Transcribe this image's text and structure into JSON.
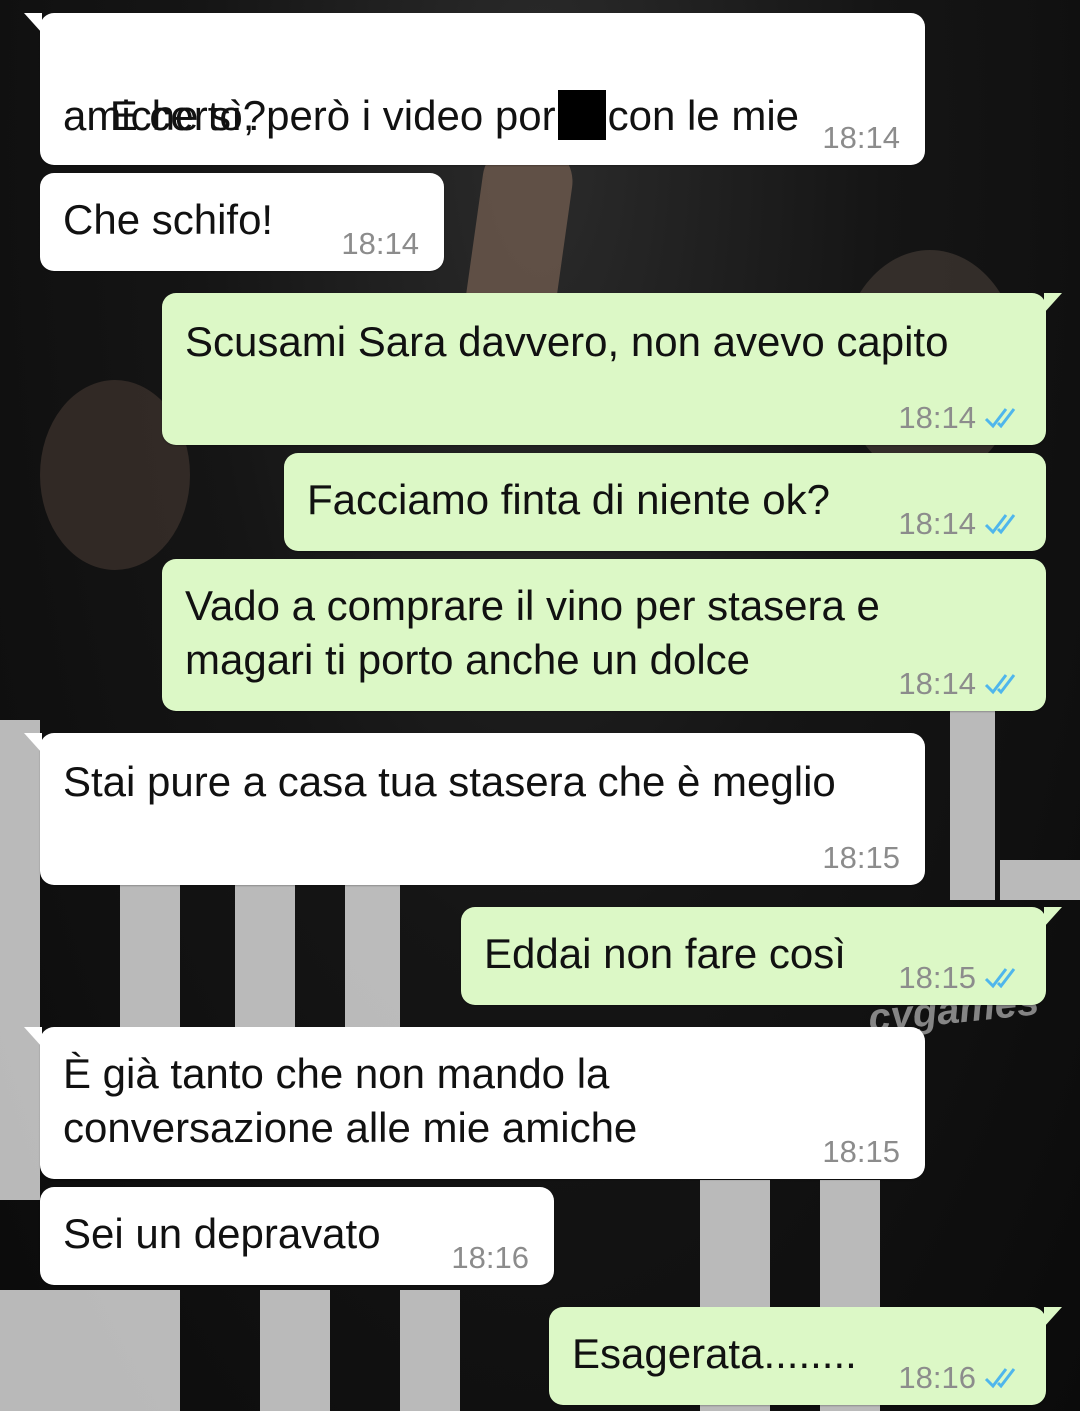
{
  "chat": {
    "watermark": "cygames",
    "messages": [
      {
        "dir": "in",
        "line1_a": "E certo, però i video por",
        "line1_b": "con le mie",
        "line2": "amiche sì?",
        "time": "18:14"
      },
      {
        "dir": "in",
        "text": "Che schifo!",
        "time": "18:14"
      },
      {
        "dir": "out",
        "text": "Scusami Sara davvero, non avevo capito",
        "time": "18:14",
        "status": "read"
      },
      {
        "dir": "out",
        "text": "Facciamo finta di niente ok?",
        "time": "18:14",
        "status": "read"
      },
      {
        "dir": "out",
        "line1": "Vado a comprare il vino per stasera e",
        "line2": "magari ti porto anche un dolce",
        "time": "18:14",
        "status": "read"
      },
      {
        "dir": "in",
        "text": "Stai pure a casa tua stasera che è meglio",
        "time": "18:15"
      },
      {
        "dir": "out",
        "text": "Eddai non fare così",
        "time": "18:15",
        "status": "read"
      },
      {
        "dir": "in",
        "line1": "È già tanto che non mando la",
        "line2": "conversazione alle mie amiche",
        "time": "18:15"
      },
      {
        "dir": "in",
        "text": "Sei un depravato",
        "time": "18:16"
      },
      {
        "dir": "out",
        "text": "Esagerata........",
        "time": "18:16",
        "status": "read"
      }
    ]
  },
  "colors": {
    "incoming_bubble": "#ffffff",
    "outgoing_bubble": "#dcf8c6",
    "read_ticks": "#4fb6ec",
    "timestamp": "#8c8c8c"
  },
  "icons": {
    "read_receipt": "double-check-icon"
  }
}
